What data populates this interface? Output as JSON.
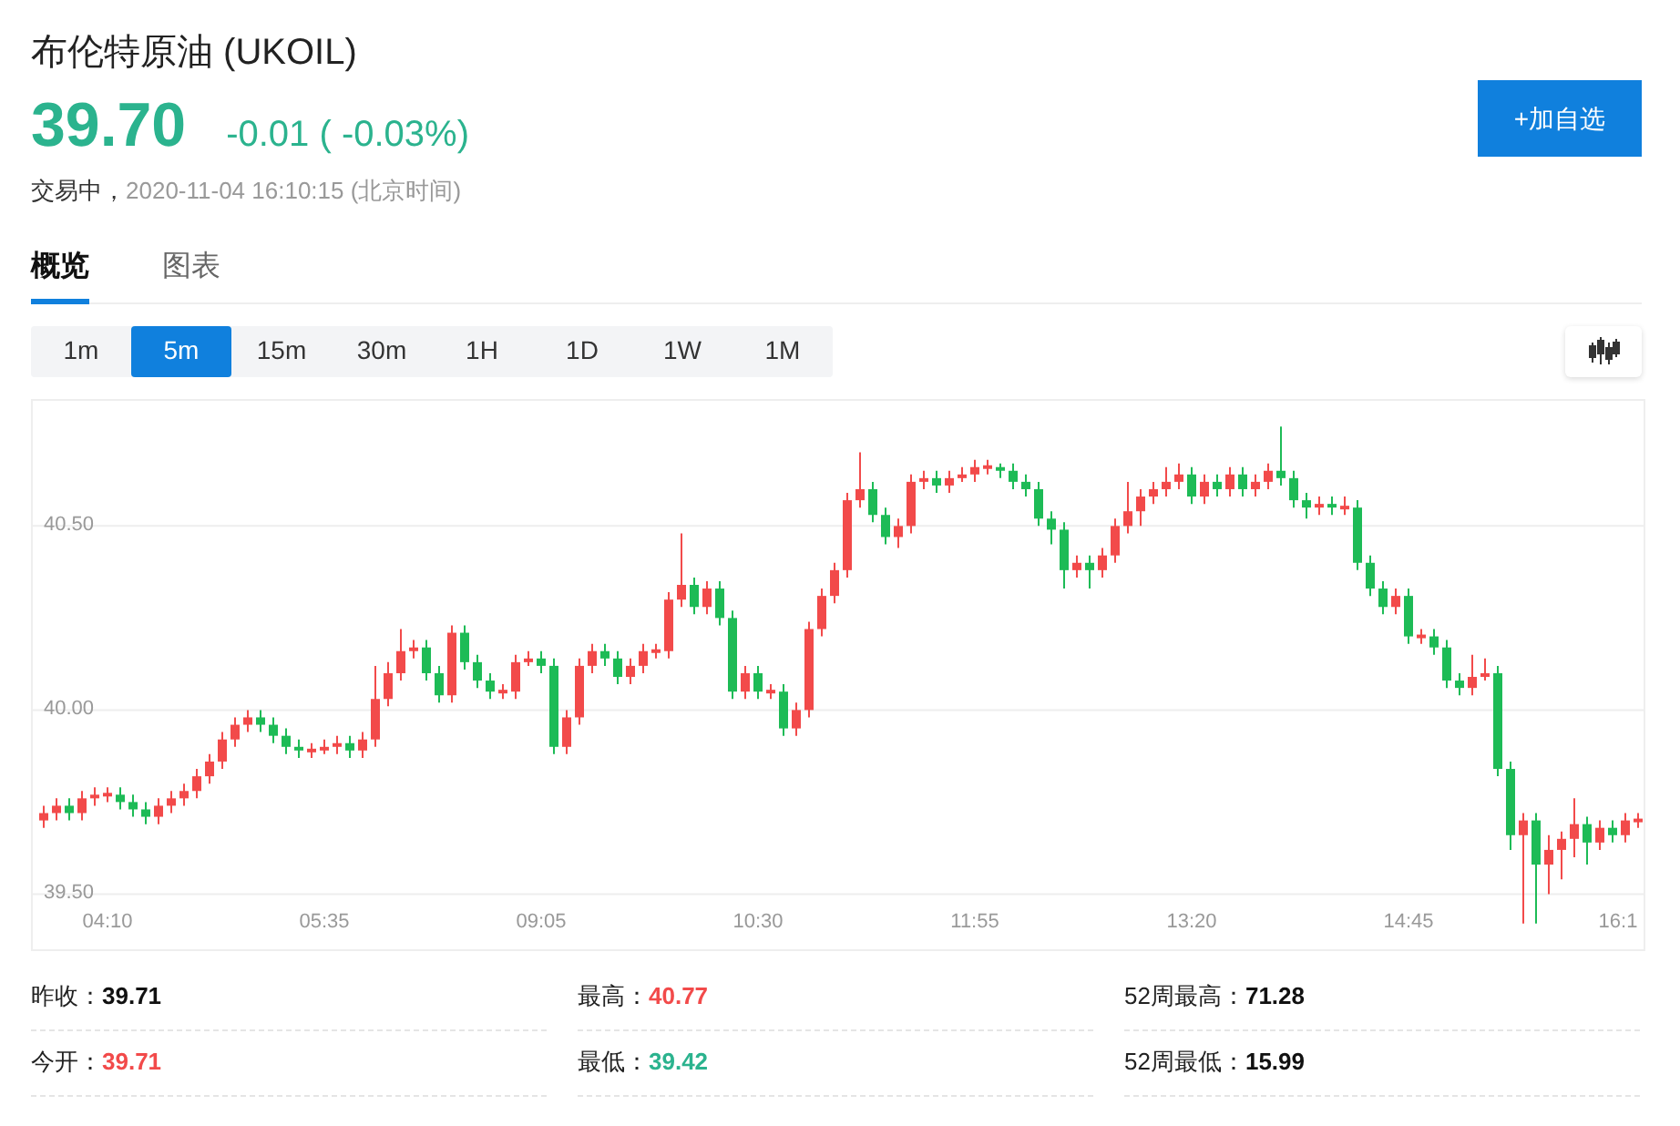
{
  "title": "布伦特原油 (UKOIL)",
  "quote": {
    "price": "39.70",
    "change": "-0.01 ( -0.03%)",
    "color": "#2bb38e"
  },
  "status": {
    "state": "交易中，",
    "time": "2020-11-04 16:10:15 (北京时间)"
  },
  "add_button": "+加自选",
  "tabs": [
    {
      "label": "概览",
      "selected": true
    },
    {
      "label": "图表",
      "selected": false
    }
  ],
  "intervals": [
    {
      "label": "1m",
      "selected": false
    },
    {
      "label": "5m",
      "selected": true
    },
    {
      "label": "15m",
      "selected": false
    },
    {
      "label": "30m",
      "selected": false
    },
    {
      "label": "1H",
      "selected": false
    },
    {
      "label": "1D",
      "selected": false
    },
    {
      "label": "1W",
      "selected": false
    },
    {
      "label": "1M",
      "selected": false
    }
  ],
  "chart_data": {
    "type": "candlestick",
    "grid": true,
    "ylim": [
      39.35,
      40.84
    ],
    "yticks": [
      {
        "value": 40.5,
        "label": "40.50"
      },
      {
        "value": 40.0,
        "label": "40.00"
      },
      {
        "value": 39.5,
        "label": "39.50"
      }
    ],
    "categories": [
      null,
      null,
      null,
      null,
      null,
      "04:10",
      null,
      null,
      null,
      null,
      null,
      null,
      null,
      null,
      null,
      null,
      null,
      null,
      null,
      null,
      null,
      null,
      "05:35",
      null,
      null,
      null,
      null,
      null,
      null,
      null,
      null,
      null,
      null,
      null,
      null,
      null,
      null,
      null,
      null,
      "09:05",
      null,
      null,
      null,
      null,
      null,
      null,
      null,
      null,
      null,
      null,
      null,
      null,
      null,
      null,
      null,
      null,
      "10:30",
      null,
      null,
      null,
      null,
      null,
      null,
      null,
      null,
      null,
      null,
      null,
      null,
      null,
      null,
      null,
      null,
      "11:55",
      null,
      null,
      null,
      null,
      null,
      null,
      null,
      null,
      null,
      null,
      null,
      null,
      null,
      null,
      null,
      null,
      "13:20",
      null,
      null,
      null,
      null,
      null,
      null,
      null,
      null,
      null,
      null,
      null,
      null,
      null,
      null,
      null,
      null,
      "14:45",
      null,
      null,
      null,
      null,
      null,
      null,
      null,
      null,
      null,
      null,
      null,
      null,
      null,
      null,
      null,
      null,
      "16:1",
      null
    ],
    "ohlc": [
      [
        39.7,
        39.74,
        39.68,
        39.72
      ],
      [
        39.72,
        39.76,
        39.7,
        39.74
      ],
      [
        39.74,
        39.76,
        39.7,
        39.72
      ],
      [
        39.72,
        39.78,
        39.7,
        39.76
      ],
      [
        39.76,
        39.79,
        39.74,
        39.77
      ],
      [
        39.77,
        39.79,
        39.75,
        39.77
      ],
      [
        39.77,
        39.79,
        39.73,
        39.75
      ],
      [
        39.75,
        39.77,
        39.71,
        39.73
      ],
      [
        39.73,
        39.75,
        39.69,
        39.71
      ],
      [
        39.71,
        39.76,
        39.69,
        39.74
      ],
      [
        39.74,
        39.78,
        39.72,
        39.76
      ],
      [
        39.76,
        39.8,
        39.74,
        39.78
      ],
      [
        39.78,
        39.84,
        39.76,
        39.82
      ],
      [
        39.82,
        39.88,
        39.8,
        39.86
      ],
      [
        39.86,
        39.94,
        39.84,
        39.92
      ],
      [
        39.92,
        39.98,
        39.9,
        39.96
      ],
      [
        39.96,
        40.0,
        39.94,
        39.98
      ],
      [
        39.98,
        40.0,
        39.94,
        39.96
      ],
      [
        39.96,
        39.98,
        39.91,
        39.93
      ],
      [
        39.93,
        39.95,
        39.88,
        39.9
      ],
      [
        39.9,
        39.92,
        39.87,
        39.89
      ],
      [
        39.89,
        39.91,
        39.87,
        39.89
      ],
      [
        39.89,
        39.92,
        39.88,
        39.9
      ],
      [
        39.9,
        39.93,
        39.88,
        39.91
      ],
      [
        39.91,
        39.93,
        39.87,
        39.89
      ],
      [
        39.89,
        39.94,
        39.87,
        39.92
      ],
      [
        39.92,
        40.12,
        39.9,
        40.03
      ],
      [
        40.03,
        40.13,
        40.01,
        40.1
      ],
      [
        40.1,
        40.22,
        40.08,
        40.16
      ],
      [
        40.16,
        40.19,
        40.14,
        40.17
      ],
      [
        40.17,
        40.19,
        40.08,
        40.1
      ],
      [
        40.1,
        40.12,
        40.02,
        40.04
      ],
      [
        40.04,
        40.23,
        40.02,
        40.21
      ],
      [
        40.21,
        40.23,
        40.11,
        40.13
      ],
      [
        40.13,
        40.15,
        40.06,
        40.08
      ],
      [
        40.08,
        40.1,
        40.03,
        40.05
      ],
      [
        40.05,
        40.07,
        40.03,
        40.05
      ],
      [
        40.05,
        40.15,
        40.03,
        40.13
      ],
      [
        40.13,
        40.16,
        40.12,
        40.14
      ],
      [
        40.14,
        40.16,
        40.1,
        40.12
      ],
      [
        40.12,
        40.14,
        39.88,
        39.9
      ],
      [
        39.9,
        40.0,
        39.88,
        39.98
      ],
      [
        39.98,
        40.14,
        39.96,
        40.12
      ],
      [
        40.12,
        40.18,
        40.1,
        40.16
      ],
      [
        40.16,
        40.18,
        40.12,
        40.14
      ],
      [
        40.14,
        40.16,
        40.07,
        40.09
      ],
      [
        40.09,
        40.14,
        40.07,
        40.12
      ],
      [
        40.12,
        40.18,
        40.1,
        40.16
      ],
      [
        40.16,
        40.18,
        40.14,
        40.16
      ],
      [
        40.16,
        40.32,
        40.14,
        40.3
      ],
      [
        40.3,
        40.48,
        40.28,
        40.34
      ],
      [
        40.34,
        40.36,
        40.26,
        40.28
      ],
      [
        40.28,
        40.35,
        40.26,
        40.33
      ],
      [
        40.33,
        40.35,
        40.23,
        40.25
      ],
      [
        40.25,
        40.27,
        40.03,
        40.05
      ],
      [
        40.05,
        40.12,
        40.03,
        40.1
      ],
      [
        40.1,
        40.12,
        40.03,
        40.05
      ],
      [
        40.05,
        40.07,
        40.03,
        40.05
      ],
      [
        40.05,
        40.07,
        39.93,
        39.95
      ],
      [
        39.95,
        40.02,
        39.93,
        40.0
      ],
      [
        40.0,
        40.24,
        39.98,
        40.22
      ],
      [
        40.22,
        40.33,
        40.2,
        40.31
      ],
      [
        40.31,
        40.4,
        40.29,
        40.38
      ],
      [
        40.38,
        40.59,
        40.36,
        40.57
      ],
      [
        40.57,
        40.7,
        40.55,
        40.6
      ],
      [
        40.6,
        40.62,
        40.51,
        40.53
      ],
      [
        40.53,
        40.55,
        40.45,
        40.47
      ],
      [
        40.47,
        40.52,
        40.44,
        40.5
      ],
      [
        40.5,
        40.64,
        40.48,
        40.62
      ],
      [
        40.62,
        40.65,
        40.6,
        40.63
      ],
      [
        40.63,
        40.65,
        40.59,
        40.61
      ],
      [
        40.61,
        40.65,
        40.59,
        40.63
      ],
      [
        40.63,
        40.66,
        40.62,
        40.64
      ],
      [
        40.64,
        40.68,
        40.62,
        40.66
      ],
      [
        40.66,
        40.68,
        40.64,
        40.66
      ],
      [
        40.66,
        40.67,
        40.63,
        40.65
      ],
      [
        40.65,
        40.67,
        40.6,
        40.62
      ],
      [
        40.62,
        40.64,
        40.58,
        40.6
      ],
      [
        40.6,
        40.62,
        40.5,
        40.52
      ],
      [
        40.52,
        40.54,
        40.45,
        40.49
      ],
      [
        40.49,
        40.51,
        40.33,
        40.38
      ],
      [
        40.38,
        40.42,
        40.36,
        40.4
      ],
      [
        40.4,
        40.42,
        40.33,
        40.38
      ],
      [
        40.38,
        40.44,
        40.36,
        40.42
      ],
      [
        40.42,
        40.52,
        40.4,
        40.5
      ],
      [
        40.5,
        40.62,
        40.48,
        40.54
      ],
      [
        40.54,
        40.6,
        40.5,
        40.58
      ],
      [
        40.58,
        40.62,
        40.56,
        40.6
      ],
      [
        40.6,
        40.66,
        40.58,
        40.62
      ],
      [
        40.62,
        40.67,
        40.6,
        40.64
      ],
      [
        40.64,
        40.66,
        40.56,
        40.58
      ],
      [
        40.58,
        40.64,
        40.56,
        40.62
      ],
      [
        40.62,
        40.64,
        40.58,
        40.6
      ],
      [
        40.6,
        40.66,
        40.58,
        40.64
      ],
      [
        40.64,
        40.66,
        40.58,
        40.6
      ],
      [
        40.6,
        40.64,
        40.58,
        40.62
      ],
      [
        40.62,
        40.67,
        40.6,
        40.65
      ],
      [
        40.65,
        40.77,
        40.61,
        40.63
      ],
      [
        40.63,
        40.65,
        40.55,
        40.57
      ],
      [
        40.57,
        40.59,
        40.52,
        40.55
      ],
      [
        40.55,
        40.58,
        40.53,
        40.56
      ],
      [
        40.56,
        40.58,
        40.53,
        40.55
      ],
      [
        40.55,
        40.58,
        40.53,
        40.55
      ],
      [
        40.55,
        40.57,
        40.38,
        40.4
      ],
      [
        40.4,
        40.42,
        40.31,
        40.33
      ],
      [
        40.33,
        40.35,
        40.26,
        40.28
      ],
      [
        40.28,
        40.33,
        40.26,
        40.31
      ],
      [
        40.31,
        40.33,
        40.18,
        40.2
      ],
      [
        40.2,
        40.22,
        40.18,
        40.2
      ],
      [
        40.2,
        40.22,
        40.15,
        40.17
      ],
      [
        40.17,
        40.19,
        40.06,
        40.08
      ],
      [
        40.08,
        40.1,
        40.04,
        40.06
      ],
      [
        40.06,
        40.15,
        40.04,
        40.09
      ],
      [
        40.09,
        40.14,
        40.08,
        40.1
      ],
      [
        40.1,
        40.12,
        39.82,
        39.84
      ],
      [
        39.84,
        39.86,
        39.62,
        39.66
      ],
      [
        39.66,
        39.72,
        39.42,
        39.7
      ],
      [
        39.7,
        39.72,
        39.42,
        39.58
      ],
      [
        39.58,
        39.66,
        39.5,
        39.62
      ],
      [
        39.62,
        39.67,
        39.54,
        39.65
      ],
      [
        39.65,
        39.76,
        39.6,
        39.69
      ],
      [
        39.69,
        39.71,
        39.58,
        39.64
      ],
      [
        39.64,
        39.7,
        39.62,
        39.68
      ],
      [
        39.68,
        39.7,
        39.64,
        39.66
      ],
      [
        39.66,
        39.72,
        39.64,
        39.7
      ],
      [
        39.7,
        39.72,
        39.68,
        39.7
      ]
    ]
  },
  "stats": [
    {
      "label": "昨收：",
      "value": "39.71",
      "color": "#111111"
    },
    {
      "label": "最高：",
      "value": "40.77",
      "color": "#f24a4a"
    },
    {
      "label": "52周最高：",
      "value": "71.28",
      "color": "#111111"
    },
    {
      "label": "今开：",
      "value": "39.71",
      "color": "#f24a4a"
    },
    {
      "label": "最低：",
      "value": "39.42",
      "color": "#2bb38e"
    },
    {
      "label": "52周最低：",
      "value": "15.99",
      "color": "#111111"
    }
  ]
}
